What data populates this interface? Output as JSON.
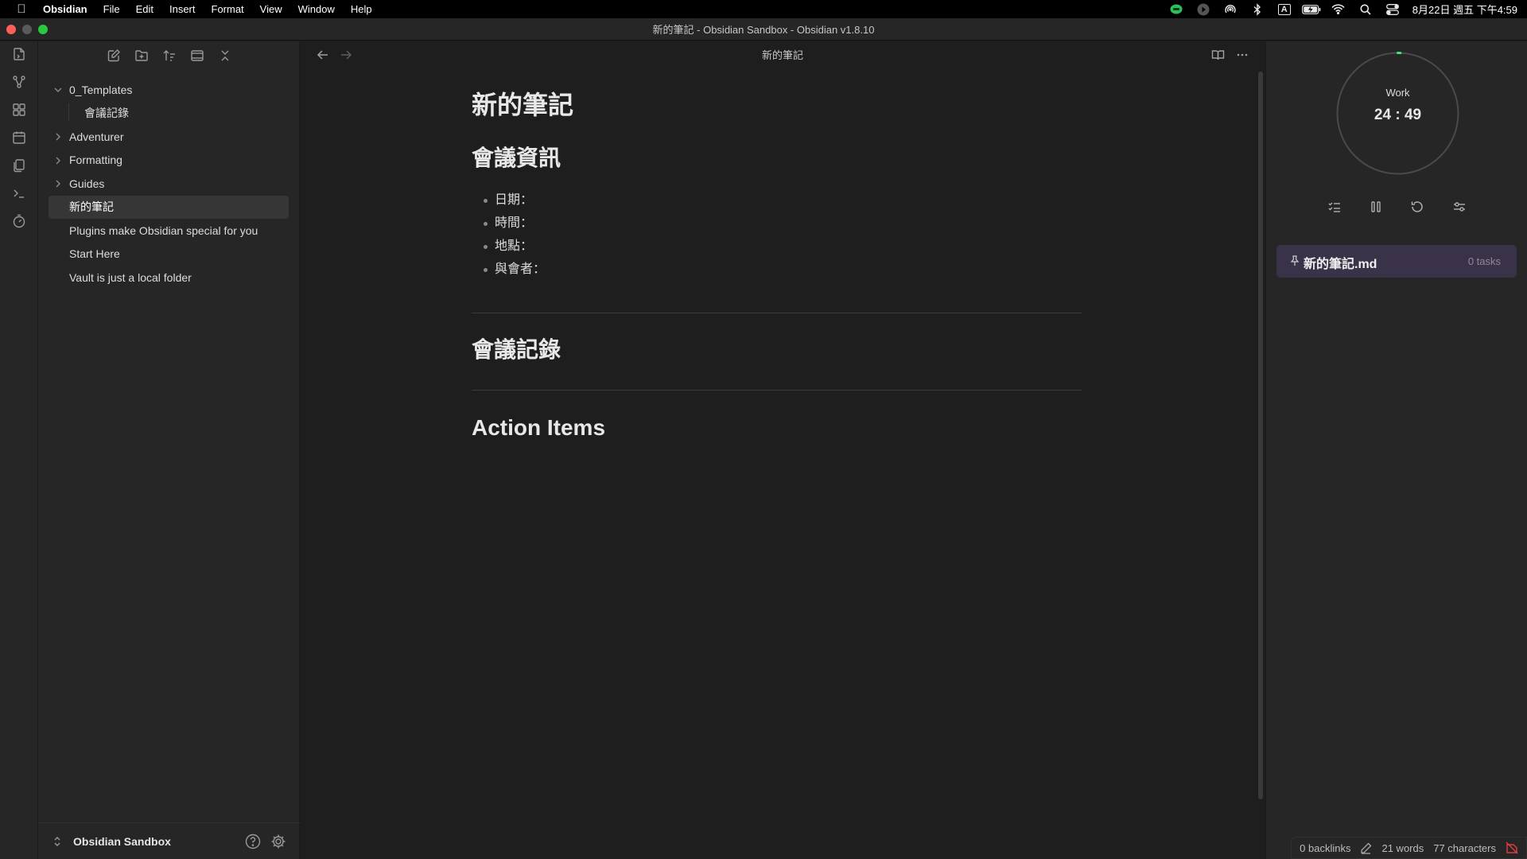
{
  "menubar": {
    "app_name": "Obsidian",
    "items": [
      "File",
      "Edit",
      "Insert",
      "Format",
      "View",
      "Window",
      "Help"
    ],
    "input_indicator": "A",
    "clock": "8月22日 週五 下午4:59"
  },
  "window": {
    "title": "新的筆記 - Obsidian Sandbox - Obsidian v1.8.10"
  },
  "file_tree": {
    "items": [
      {
        "label": "0_Templates",
        "type": "folder",
        "expanded": true
      },
      {
        "label": "會議記錄",
        "type": "file",
        "child": true
      },
      {
        "label": "Adventurer",
        "type": "folder",
        "expanded": false
      },
      {
        "label": "Formatting",
        "type": "folder",
        "expanded": false
      },
      {
        "label": "Guides",
        "type": "folder",
        "expanded": false
      },
      {
        "label": "新的筆記",
        "type": "file",
        "active": true
      },
      {
        "label": "Plugins make Obsidian special for you",
        "type": "file"
      },
      {
        "label": "Start Here",
        "type": "file"
      },
      {
        "label": "Vault is just a local folder",
        "type": "file"
      }
    ]
  },
  "vault": {
    "name": "Obsidian Sandbox"
  },
  "editor": {
    "tab_title": "新的筆記",
    "heading": "新的筆記",
    "section1": "會議資訊",
    "bullets": [
      "日期：",
      "時間：",
      "地點：",
      "與會者："
    ],
    "section2": "會議記錄",
    "section3": "Action Items"
  },
  "pomodoro": {
    "mode": "Work",
    "time": "24 : 49",
    "progress": 0.007,
    "accent": "#4ade80"
  },
  "tasks": {
    "file": "新的筆記.md",
    "count": "0 tasks"
  },
  "status": {
    "backlinks": "0 backlinks",
    "words": "21 words",
    "characters": "77 characters"
  }
}
